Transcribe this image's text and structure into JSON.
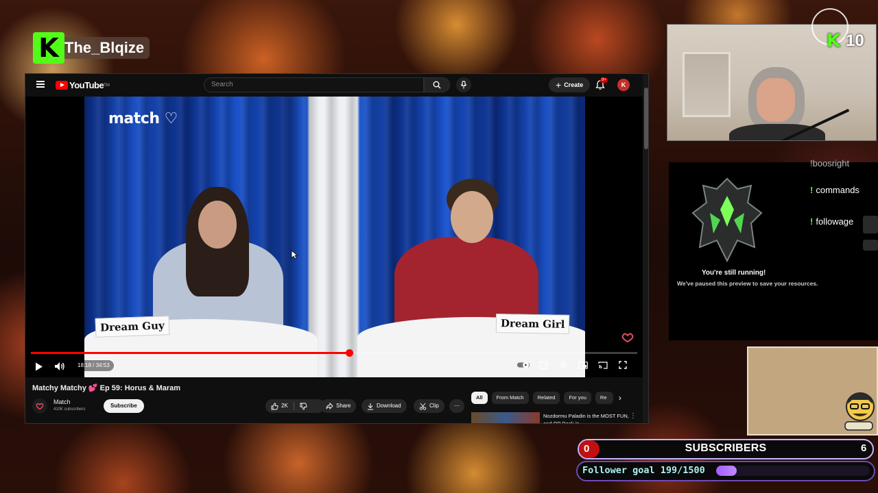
{
  "streamer": {
    "platform_icon": "kick-logo",
    "name": "The_Blqize"
  },
  "youtube": {
    "logo_text": "YouTube",
    "logo_sup": "TM",
    "search_placeholder": "Search",
    "create_label": "Create",
    "notification_badge": "9+",
    "account_initial": "K",
    "video": {
      "time": "18:18 / 34:53",
      "progress_fraction": 0.5246,
      "left_card": "Dream Guy",
      "right_card": "Dream Girl",
      "brand_text": "match"
    },
    "title": "Matchy Matchy 💕 Ep 59: Horus & Maram",
    "channel": {
      "name": "Match",
      "subscribers": "410K subscribers",
      "subscribe_label": "Subscribe"
    },
    "actions": {
      "likes": "2K",
      "share": "Share",
      "download": "Download",
      "clip": "Clip"
    },
    "filters": [
      "All",
      "From Match",
      "Related",
      "For you",
      "Re"
    ],
    "recommendation": {
      "title": "Nozdormu Paladin is the MOST FUN, and OP Deck in"
    }
  },
  "viewers": {
    "icon": "kick-logo",
    "count": "10"
  },
  "chat_panel": {
    "cut_top": "!boosright",
    "commands": [
      "commands",
      "followage"
    ],
    "paused_line1": "You're still running!",
    "paused_line2": "We've paused this preview to save your resources."
  },
  "subscribers_bar": {
    "current": "0",
    "label": "SUBSCRIBERS",
    "goal": "6"
  },
  "follower_goal": {
    "text": "Follower goal 199/1500",
    "current": 199,
    "target": 1500
  },
  "colors": {
    "kick_green": "#53fc18",
    "youtube_red": "#ff0000",
    "subs_red": "#c01010",
    "goal_purple": "#a45cff"
  }
}
